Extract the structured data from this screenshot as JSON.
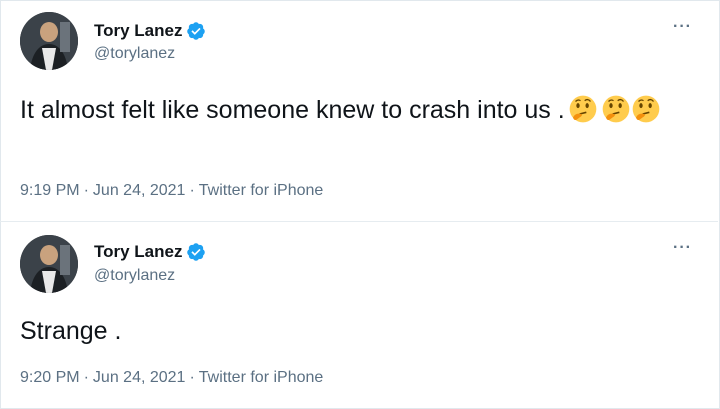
{
  "tweets": [
    {
      "display_name": "Tory Lanez",
      "handle": "@torylanez",
      "text": "It almost felt like someone knew to crash into us .",
      "emojis": [
        "thinking-face-icon",
        "thinking-face-icon",
        "thinking-face-icon"
      ],
      "time": "9:19 PM",
      "date": "Jun 24, 2021",
      "source": "Twitter for iPhone",
      "separator": "·"
    },
    {
      "display_name": "Tory Lanez",
      "handle": "@torylanez",
      "text": "Strange .",
      "time": "9:20 PM",
      "date": "Jun 24, 2021",
      "source": "Twitter for iPhone",
      "separator": "·"
    }
  ],
  "more_label": "···",
  "colors": {
    "verified": "#1da1f2",
    "secondary_text": "#5b7083",
    "primary_text": "#0f1419"
  }
}
